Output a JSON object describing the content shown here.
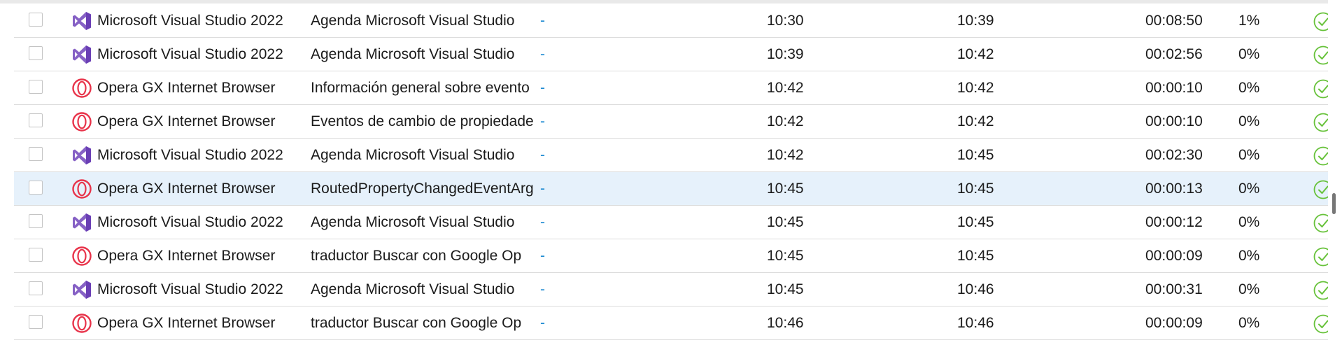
{
  "colors": {
    "selected_row": "#e6f1fb",
    "row_border": "#dcdcdc",
    "dash_link": "#1f8bd2",
    "status_ok": "#67c23a",
    "vs_purple": "#8661c5",
    "opera_red": "#e8334a"
  },
  "rows": [
    {
      "app": "Microsoft Visual Studio 2022",
      "icon": "visual-studio-icon",
      "title": "Agenda  Microsoft Visual Studio",
      "extra": "-",
      "start": "10:30",
      "end": "10:39",
      "duration": "00:08:50",
      "percent": "1%",
      "status_icon": "check-circle-icon",
      "selected": false
    },
    {
      "app": "Microsoft Visual Studio 2022",
      "icon": "visual-studio-icon",
      "title": "Agenda  Microsoft Visual Studio",
      "extra": "-",
      "start": "10:39",
      "end": "10:42",
      "duration": "00:02:56",
      "percent": "0%",
      "status_icon": "check-circle-icon",
      "selected": false
    },
    {
      "app": "Opera GX Internet Browser",
      "icon": "opera-gx-icon",
      "title": "Información general sobre evento",
      "extra": "-",
      "start": "10:42",
      "end": "10:42",
      "duration": "00:00:10",
      "percent": "0%",
      "status_icon": "check-circle-icon",
      "selected": false
    },
    {
      "app": "Opera GX Internet Browser",
      "icon": "opera-gx-icon",
      "title": "Eventos de cambio de propiedade",
      "extra": "-",
      "start": "10:42",
      "end": "10:42",
      "duration": "00:00:10",
      "percent": "0%",
      "status_icon": "check-circle-icon",
      "selected": false
    },
    {
      "app": "Microsoft Visual Studio 2022",
      "icon": "visual-studio-icon",
      "title": "Agenda  Microsoft Visual Studio",
      "extra": "-",
      "start": "10:42",
      "end": "10:45",
      "duration": "00:02:30",
      "percent": "0%",
      "status_icon": "check-circle-icon",
      "selected": false
    },
    {
      "app": "Opera GX Internet Browser",
      "icon": "opera-gx-icon",
      "title": "RoutedPropertyChangedEventArg",
      "extra": "-",
      "start": "10:45",
      "end": "10:45",
      "duration": "00:00:13",
      "percent": "0%",
      "status_icon": "check-circle-icon",
      "selected": true
    },
    {
      "app": "Microsoft Visual Studio 2022",
      "icon": "visual-studio-icon",
      "title": "Agenda  Microsoft Visual Studio",
      "extra": "-",
      "start": "10:45",
      "end": "10:45",
      "duration": "00:00:12",
      "percent": "0%",
      "status_icon": "check-circle-icon",
      "selected": false
    },
    {
      "app": "Opera GX Internet Browser",
      "icon": "opera-gx-icon",
      "title": "traductor  Buscar con Google  Op",
      "extra": "-",
      "start": "10:45",
      "end": "10:45",
      "duration": "00:00:09",
      "percent": "0%",
      "status_icon": "check-circle-icon",
      "selected": false
    },
    {
      "app": "Microsoft Visual Studio 2022",
      "icon": "visual-studio-icon",
      "title": "Agenda  Microsoft Visual Studio",
      "extra": "-",
      "start": "10:45",
      "end": "10:46",
      "duration": "00:00:31",
      "percent": "0%",
      "status_icon": "check-circle-icon",
      "selected": false
    },
    {
      "app": "Opera GX Internet Browser",
      "icon": "opera-gx-icon",
      "title": "traductor  Buscar con Google  Op",
      "extra": "-",
      "start": "10:46",
      "end": "10:46",
      "duration": "00:00:09",
      "percent": "0%",
      "status_icon": "check-circle-icon",
      "selected": false
    }
  ]
}
